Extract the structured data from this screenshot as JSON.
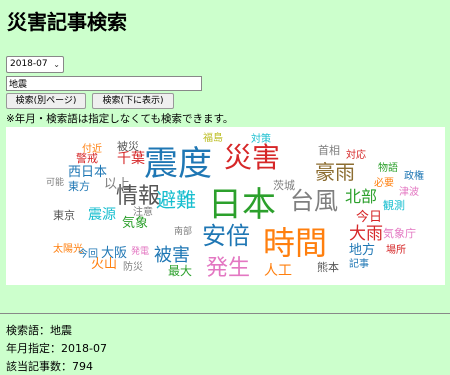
{
  "page": {
    "title": "災害記事検索",
    "month_select": "2018-07",
    "search_value": "地震",
    "btn_new_page": "検索(別ページ)",
    "btn_below": "検索(下に表示)",
    "note": "※年月・検索語は指定しなくても検索できます。"
  },
  "result": {
    "line_keyword": "検索語：地震",
    "line_month": "年月指定：2018-07",
    "line_count": "該当記事数：794"
  },
  "word_cloud": {
    "words": [
      {
        "text": "震度",
        "color": "#1f77b4"
      },
      {
        "text": "災害",
        "color": "#d62728"
      },
      {
        "text": "日本",
        "color": "#2ca02c"
      },
      {
        "text": "時間",
        "color": "#ff7f0e"
      },
      {
        "text": "情報",
        "color": "#555555"
      },
      {
        "text": "安倍",
        "color": "#1f77b4"
      },
      {
        "text": "避難",
        "color": "#17becf"
      },
      {
        "text": "台風",
        "color": "#7f7f7f"
      },
      {
        "text": "豪雨",
        "color": "#8c6d31"
      },
      {
        "text": "発生",
        "color": "#e377c2"
      },
      {
        "text": "被害",
        "color": "#1f77b4"
      },
      {
        "text": "大雨",
        "color": "#d62728"
      },
      {
        "text": "北部",
        "color": "#2ca02c"
      },
      {
        "text": "西日本",
        "color": "#1f77b4"
      },
      {
        "text": "震源",
        "color": "#17becf"
      },
      {
        "text": "気象",
        "color": "#2ca02c"
      },
      {
        "text": "人工",
        "color": "#ff7f0e"
      },
      {
        "text": "以上",
        "color": "#7f7f7f"
      },
      {
        "text": "千葉",
        "color": "#d62728"
      },
      {
        "text": "今日",
        "color": "#d62728"
      },
      {
        "text": "地方",
        "color": "#1f77b4"
      },
      {
        "text": "首相",
        "color": "#7f7f7f"
      },
      {
        "text": "茨城",
        "color": "#7f7f7f"
      },
      {
        "text": "大阪",
        "color": "#1f77b4"
      },
      {
        "text": "火山",
        "color": "#ff7f0e"
      },
      {
        "text": "最大",
        "color": "#2ca02c"
      },
      {
        "text": "熊本",
        "color": "#555555"
      },
      {
        "text": "東方",
        "color": "#1f77b4"
      },
      {
        "text": "東京",
        "color": "#555555"
      },
      {
        "text": "太陽光",
        "color": "#ff7f0e"
      },
      {
        "text": "今回",
        "color": "#1f77b4"
      },
      {
        "text": "防災",
        "color": "#7f7f7f"
      },
      {
        "text": "発電",
        "color": "#e377c2"
      },
      {
        "text": "注意",
        "color": "#7f7f7f"
      },
      {
        "text": "南部",
        "color": "#7f7f7f"
      },
      {
        "text": "福島",
        "color": "#bcbd22"
      },
      {
        "text": "対策",
        "color": "#17becf"
      },
      {
        "text": "被災",
        "color": "#555555"
      },
      {
        "text": "警戒",
        "color": "#d62728"
      },
      {
        "text": "付近",
        "color": "#ff7f0e"
      },
      {
        "text": "可能",
        "color": "#7f7f7f"
      },
      {
        "text": "対応",
        "color": "#d62728"
      },
      {
        "text": "物語",
        "color": "#2ca02c"
      },
      {
        "text": "必要",
        "color": "#ff7f0e"
      },
      {
        "text": "政権",
        "color": "#1f77b4"
      },
      {
        "text": "津波",
        "color": "#e377c2"
      },
      {
        "text": "観測",
        "color": "#17becf"
      },
      {
        "text": "気象庁",
        "color": "#e377c2"
      },
      {
        "text": "場所",
        "color": "#d62728"
      },
      {
        "text": "記事",
        "color": "#1f77b4"
      }
    ]
  }
}
